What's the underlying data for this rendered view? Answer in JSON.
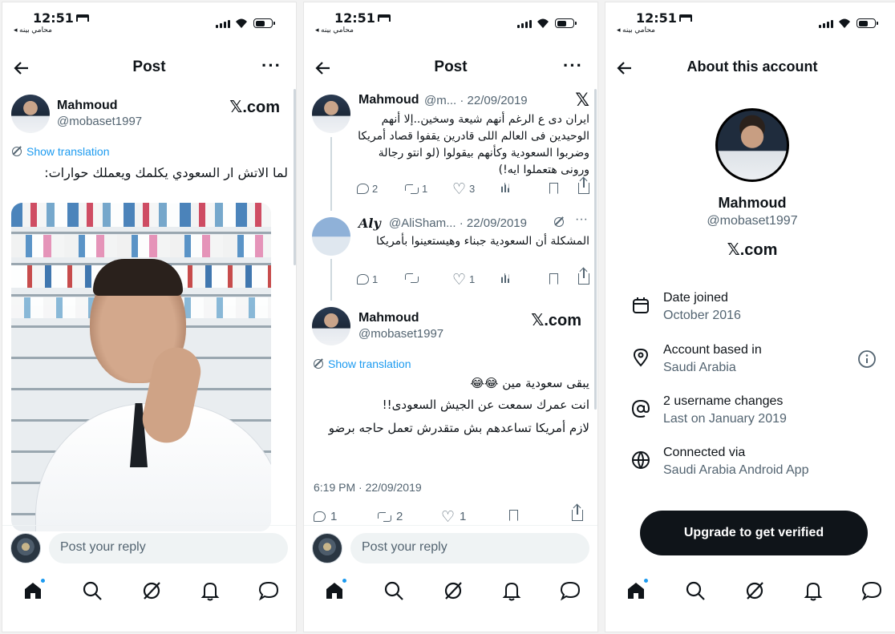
{
  "status": {
    "time": "12:51",
    "carrier": "محامي بينه"
  },
  "colors": {
    "accent": "#1d9bf0",
    "text": "#0f1419",
    "muted": "#536471",
    "button": "#0f1419"
  },
  "screen1": {
    "header_title": "Post",
    "author": {
      "name": "Mahmoud",
      "handle": "@mobaset1997",
      "bio_link": "𝕏.com"
    },
    "show_translation": "Show translation",
    "text": "لما الاتش ار السعودي يكلمك ويعملك حوارات:"
  },
  "screen2": {
    "header_title": "Post",
    "tweet1": {
      "name": "Mahmoud",
      "handle_date": "@m... · 22/09/2019",
      "text": "ايران دى ع الرغم أنهم شيعة وسخين..إلا أنهم الوحيدين فى العالم اللى قادرين يقفوا قصاد أمريكا وضربوا السعودية وكأنهم بيقولوا (لو انتو رجالة ورونى هتعملوا ايه!)",
      "replies": "2",
      "reposts": "1",
      "likes": "3"
    },
    "tweet2": {
      "name": "Aly",
      "handle_date": "@AliSham... · 22/09/2019",
      "text": "المشكلة أن السعودية جبناء وهيستعينوا بأمريكا",
      "replies": "1",
      "reposts": "",
      "likes": "1"
    },
    "tweet3": {
      "name": "Mahmoud",
      "handle": "@mobaset1997",
      "bio_link": "𝕏.com",
      "show_translation": "Show translation",
      "line1": "يبقى سعودية مين 😂😂",
      "line2": "انت عمرك سمعت عن الجيش السعودى!!",
      "line3": "لازم أمريكا تساعدهم بش متقدرش تعمل حاجه برضو",
      "meta": "6:19 PM · 22/09/2019",
      "replies": "1",
      "reposts": "2",
      "likes": "1"
    }
  },
  "screen3": {
    "header_title": "About this account",
    "name": "Mahmoud",
    "handle": "@mobaset1997",
    "bio_link": "𝕏.com",
    "rows": [
      {
        "icon": "calendar-icon",
        "title": "Date joined",
        "value": "October 2016"
      },
      {
        "icon": "location-pin-icon",
        "title": "Account based in",
        "value": "Saudi Arabia"
      },
      {
        "icon": "at-sign-icon",
        "title": "2 username changes",
        "value": "Last on January 2019"
      },
      {
        "icon": "globe-icon",
        "title": "Connected via",
        "value": "Saudi Arabia Android App"
      }
    ],
    "upgrade_button": "Upgrade to get verified"
  },
  "reply_placeholder": "Post your reply"
}
